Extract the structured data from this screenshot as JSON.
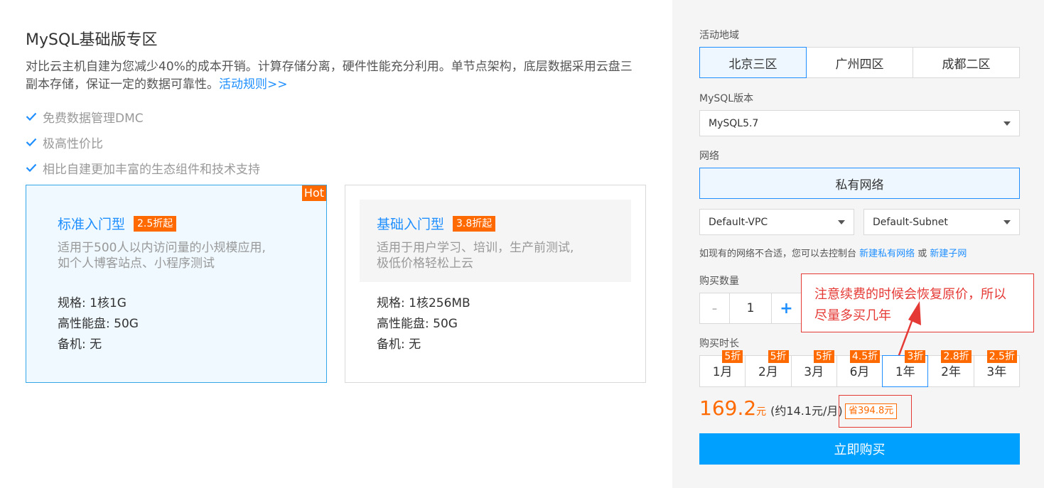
{
  "left": {
    "title": "MySQL基础版专区",
    "desc_text": "对比云主机自建为您减少40%的成本开销。计算存储分离，硬件性能充分利用。单节点架构，底层数据采用云盘三副本存储，保证一定的数据可靠性。",
    "desc_link": "活动规则>>",
    "features": [
      "免费数据管理DMC",
      "极高性价比",
      "相比自建更加丰富的生态组件和技术支持"
    ],
    "cards": [
      {
        "name": "标准入门型",
        "tag": "2.5折起",
        "hot": "Hot",
        "sub1": "适用于500人以内访问量的小规模应用,",
        "sub2": "如个人博客站点、小程序测试",
        "spec1": "规格: 1核1G",
        "spec2": "高性能盘: 50G",
        "spec3": "备机: 无",
        "selected": true
      },
      {
        "name": "基础入门型",
        "tag": "3.8折起",
        "sub1": "适用于用户学习、培训，生产前测试,",
        "sub2": "极低价格轻松上云",
        "spec1": "规格: 1核256MB",
        "spec2": "高性能盘: 50G",
        "spec3": "备机: 无",
        "selected": false
      }
    ]
  },
  "right": {
    "region_label": "活动地域",
    "regions": [
      "北京三区",
      "广州四区",
      "成都二区"
    ],
    "selected_region": "北京三区",
    "version_label": "MySQL版本",
    "version_value": "MySQL5.7",
    "network_label": "网络",
    "network_type": "私有网络",
    "vpc_value": "Default-VPC",
    "subnet_value": "Default-Subnet",
    "hint_text": "如现有的网络不合适，您可以去控制台 ",
    "hint_link1": "新建私有网络",
    "hint_or": " 或 ",
    "hint_link2": "新建子网",
    "qty_label": "购买数量",
    "qty_minus": "-",
    "qty_value": "1",
    "qty_plus": "+",
    "duration_label": "购买时长",
    "durations": [
      {
        "label": "1月",
        "discount": "5折"
      },
      {
        "label": "2月",
        "discount": "5折"
      },
      {
        "label": "3月",
        "discount": "5折"
      },
      {
        "label": "6月",
        "discount": "4.5折"
      },
      {
        "label": "1年",
        "discount": "3折"
      },
      {
        "label": "2年",
        "discount": "2.8折"
      },
      {
        "label": "3年",
        "discount": "2.5折"
      }
    ],
    "selected_duration": "1年",
    "price": "169.2",
    "price_unit": "元",
    "price_per_month": "(约14.1元/月)",
    "save_text": "省394.8元",
    "buy_button": "立即购买"
  },
  "annotation": {
    "line1": "注意续费的时候会恢复原价，所以",
    "line2": "尽量多买几年"
  },
  "colors": {
    "accent": "#1f8fff",
    "orange": "#ff6a00",
    "annotation_red": "#e53935",
    "buy_button": "#00a0ff"
  }
}
